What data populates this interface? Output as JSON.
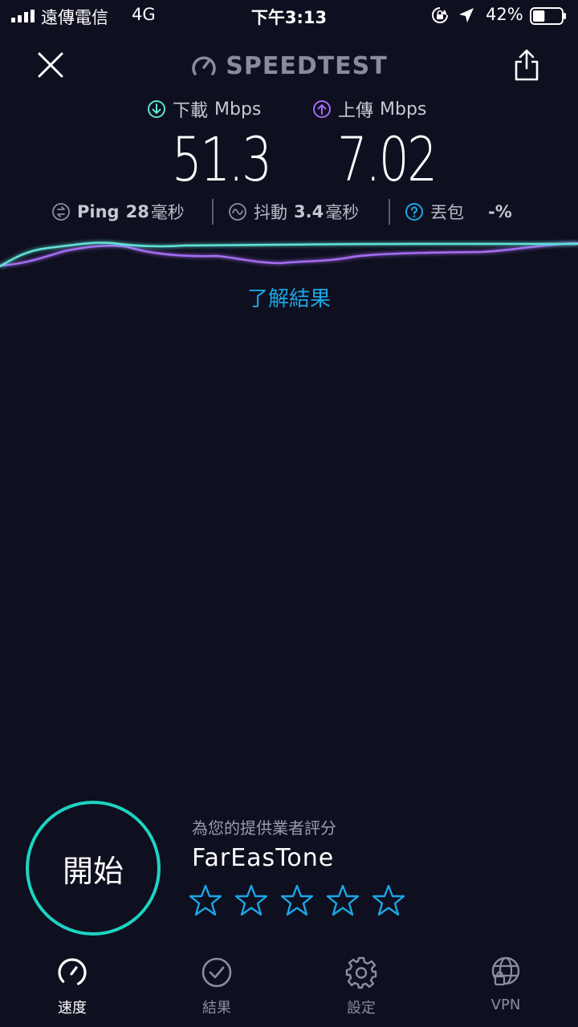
{
  "status_bar": {
    "carrier": "遠傳電信",
    "network": "4G",
    "time": "下午3:13",
    "battery": "42%",
    "battery_level": 0.42
  },
  "header": {
    "logo_text": "SPEEDTEST"
  },
  "results": {
    "download_label": "下載",
    "download_unit": "Mbps",
    "download_value": "51.3",
    "upload_label": "上傳",
    "upload_unit": "Mbps",
    "upload_value": "7.02",
    "ping_label": "Ping",
    "ping_value": "28",
    "ping_unit": "毫秒",
    "jitter_label": "抖動",
    "jitter_value": "3.4",
    "jitter_unit": "毫秒",
    "loss_label": "丟包",
    "loss_value": "-%"
  },
  "learn_more": "了解結果",
  "go_button": "開始",
  "rating": {
    "prompt": "為您的提供業者評分",
    "provider": "FarEasTone",
    "stars": 5
  },
  "tabs": [
    {
      "label": "速度",
      "icon": "speedometer-icon",
      "active": true
    },
    {
      "label": "結果",
      "icon": "check-circle-icon",
      "active": false
    },
    {
      "label": "設定",
      "icon": "gear-icon",
      "active": false
    },
    {
      "label": "VPN",
      "icon": "globe-lock-icon",
      "active": false
    }
  ],
  "colors": {
    "background": "#0e0f1f",
    "download": "#5fe3d6",
    "upload": "#a56cf0",
    "accent_link": "#1ba6e6",
    "go_ring": "#1dd3c2"
  }
}
